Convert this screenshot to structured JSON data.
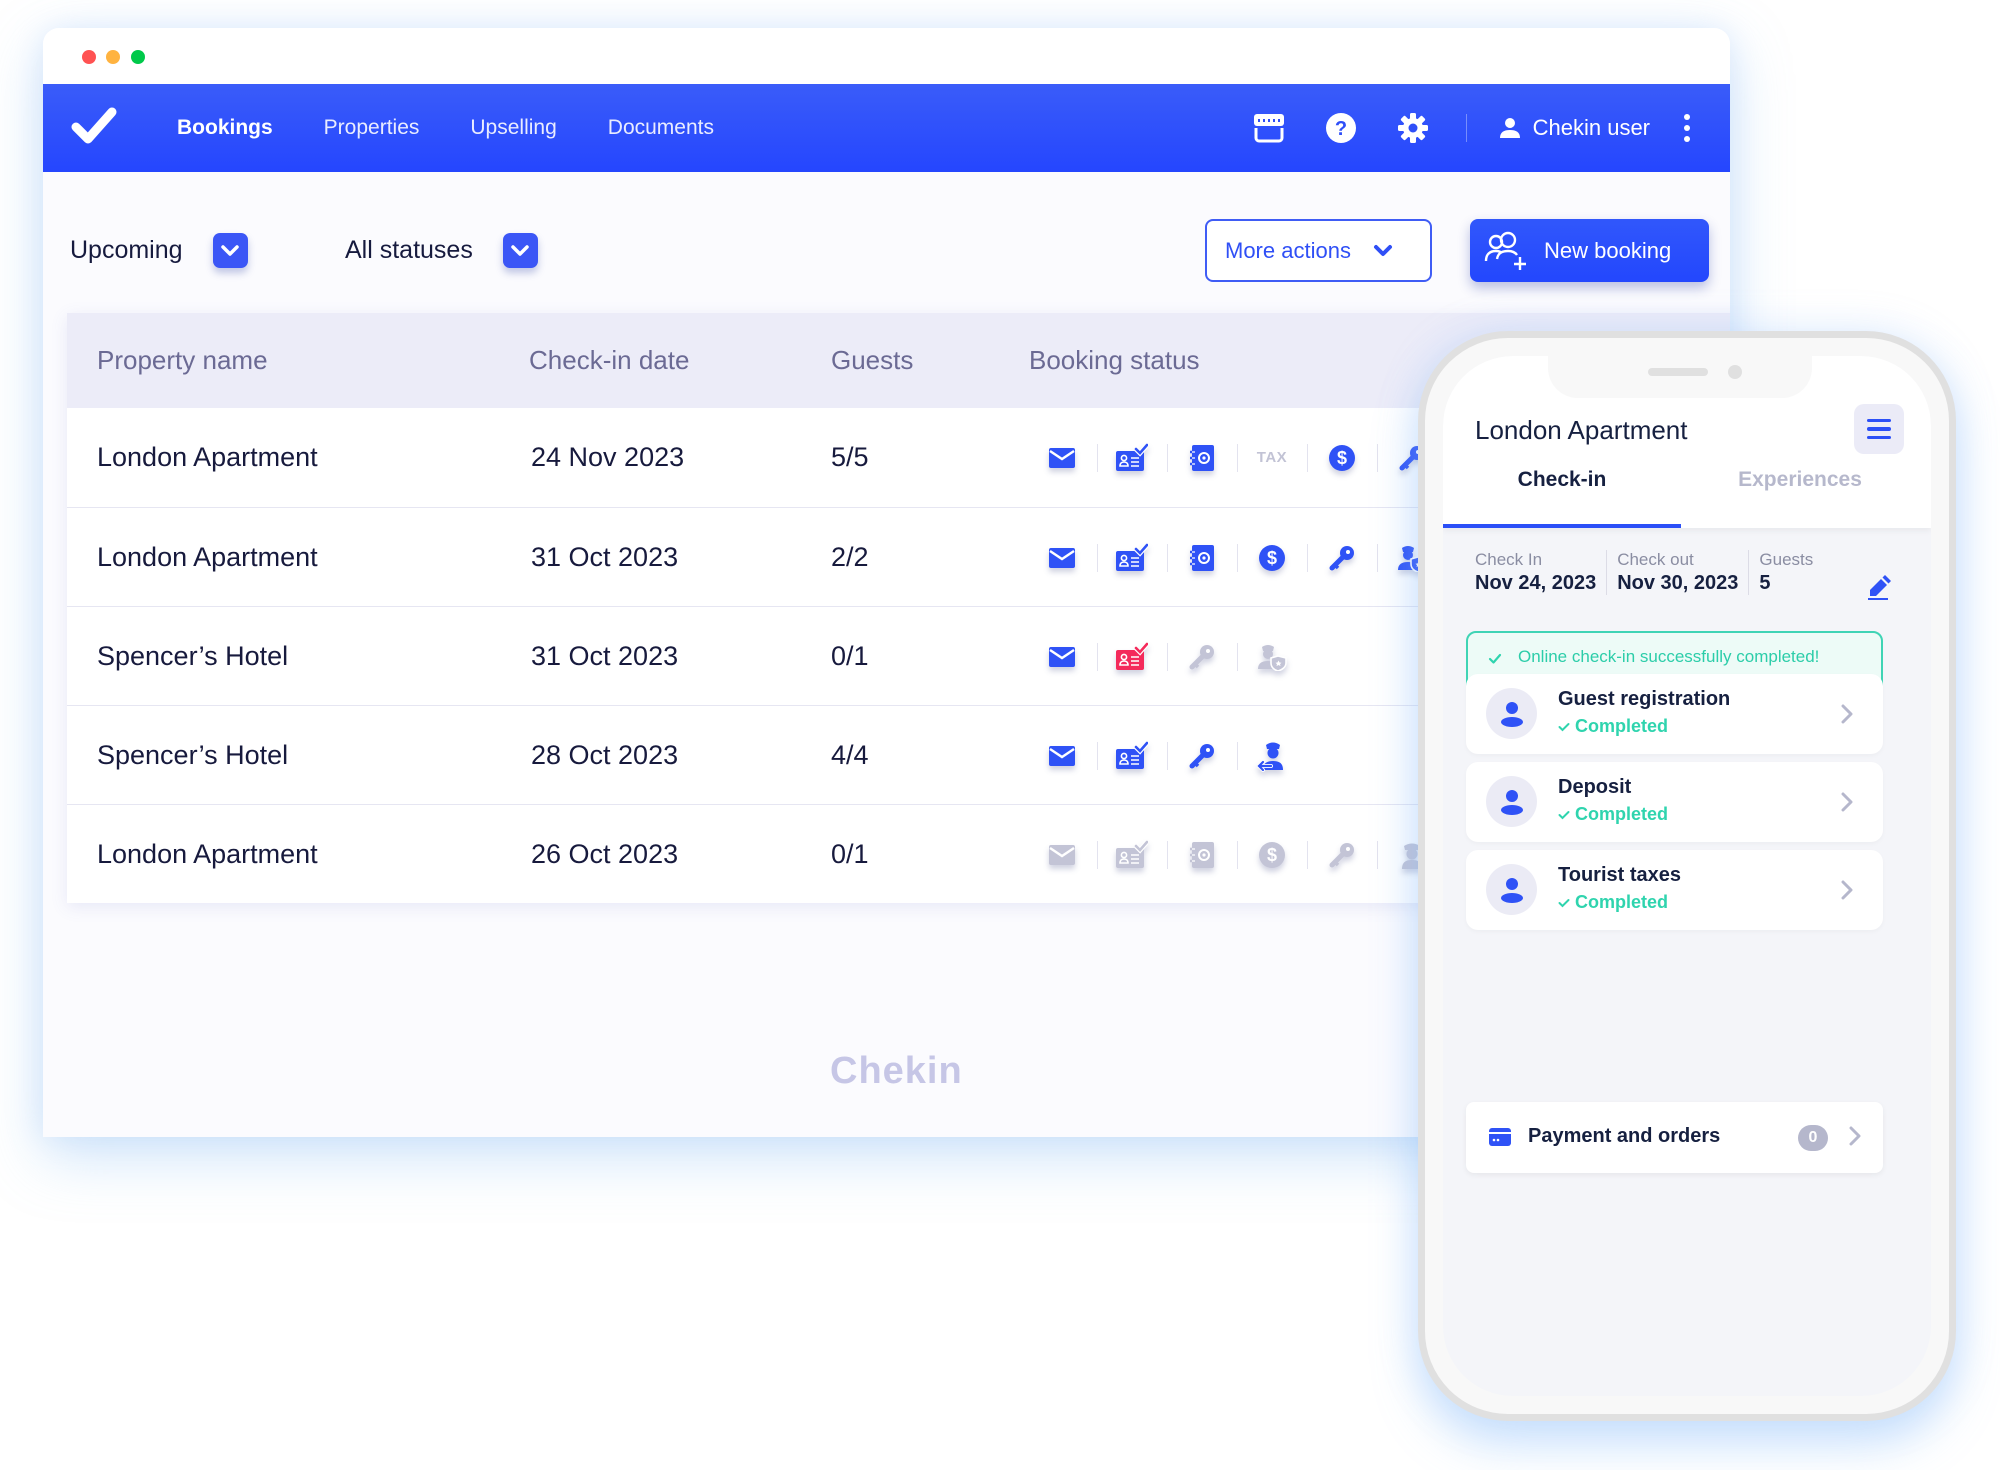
{
  "window": {
    "traffic_lights": [
      "close",
      "minimize",
      "maximize"
    ]
  },
  "navbar": {
    "logo": "chekin-check-logo",
    "items": [
      {
        "label": "Bookings",
        "active": true
      },
      {
        "label": "Properties",
        "active": false
      },
      {
        "label": "Upselling",
        "active": false
      },
      {
        "label": "Documents",
        "active": false
      }
    ],
    "icons": [
      "store-icon",
      "help-icon",
      "gear-icon"
    ],
    "user_name": "Chekin user",
    "accent": "#2b4ff7"
  },
  "toolbar": {
    "filter_period": "Upcoming",
    "filter_status": "All statuses",
    "more_actions_label": "More actions",
    "new_booking_label": "New booking"
  },
  "table": {
    "headers": {
      "property": "Property name",
      "checkin": "Check-in date",
      "guests": "Guests",
      "status": "Booking status"
    },
    "rows": [
      {
        "property": "London Apartment",
        "checkin": "24 Nov 2023",
        "guests": "5/5",
        "status_icons": [
          {
            "type": "email",
            "state": "done"
          },
          {
            "type": "id-card",
            "state": "done"
          },
          {
            "type": "safe",
            "state": "done"
          },
          {
            "type": "tax",
            "state": "inactive",
            "label": "TAX"
          },
          {
            "type": "dollar",
            "state": "done"
          },
          {
            "type": "key",
            "state": "done"
          }
        ]
      },
      {
        "property": "London Apartment",
        "checkin": "31 Oct 2023",
        "guests": "2/2",
        "status_icons": [
          {
            "type": "email",
            "state": "done"
          },
          {
            "type": "id-card",
            "state": "done"
          },
          {
            "type": "safe",
            "state": "done"
          },
          {
            "type": "dollar",
            "state": "done"
          },
          {
            "type": "key",
            "state": "done"
          },
          {
            "type": "police-shield",
            "state": "done"
          }
        ]
      },
      {
        "property": "Spencer’s Hotel",
        "checkin": "31 Oct 2023",
        "guests": "0/1",
        "status_icons": [
          {
            "type": "email",
            "state": "done"
          },
          {
            "type": "id-card",
            "state": "error"
          },
          {
            "type": "key",
            "state": "inactive"
          },
          {
            "type": "police-shield",
            "state": "inactive"
          }
        ]
      },
      {
        "property": "Spencer’s Hotel",
        "checkin": "28 Oct 2023",
        "guests": "4/4",
        "status_icons": [
          {
            "type": "email",
            "state": "done"
          },
          {
            "type": "id-card",
            "state": "done"
          },
          {
            "type": "key",
            "state": "done"
          },
          {
            "type": "police-transfer",
            "state": "done"
          }
        ]
      },
      {
        "property": "London Apartment",
        "checkin": "26 Oct 2023",
        "guests": "0/1",
        "status_icons": [
          {
            "type": "email",
            "state": "inactive"
          },
          {
            "type": "id-card",
            "state": "inactive"
          },
          {
            "type": "safe",
            "state": "inactive"
          },
          {
            "type": "dollar",
            "state": "inactive"
          },
          {
            "type": "key",
            "state": "inactive"
          },
          {
            "type": "police",
            "state": "inactive"
          }
        ]
      }
    ],
    "state_colors": {
      "done": "#2f52f6",
      "error": "#f42a5b",
      "inactive": "#c3c4d6"
    }
  },
  "footer": {
    "brand": "Chekin"
  },
  "phone": {
    "title": "London Apartment",
    "tabs": [
      {
        "label": "Check-in",
        "active": true
      },
      {
        "label": "Experiences",
        "active": false
      }
    ],
    "info": {
      "checkin_label": "Check In",
      "checkin_value": "Nov 24, 2023",
      "checkout_label": "Check out",
      "checkout_value": "Nov 30, 2023",
      "guests_label": "Guests",
      "guests_value": "5"
    },
    "success_message": "Online check-in successfully completed!",
    "tasks": [
      {
        "name": "Guest registration",
        "status": "Completed"
      },
      {
        "name": "Deposit",
        "status": "Completed"
      },
      {
        "name": "Tourist taxes",
        "status": "Completed"
      }
    ],
    "payment": {
      "label": "Payment and orders",
      "count": "0"
    },
    "success_color": "#2fd4ae"
  }
}
